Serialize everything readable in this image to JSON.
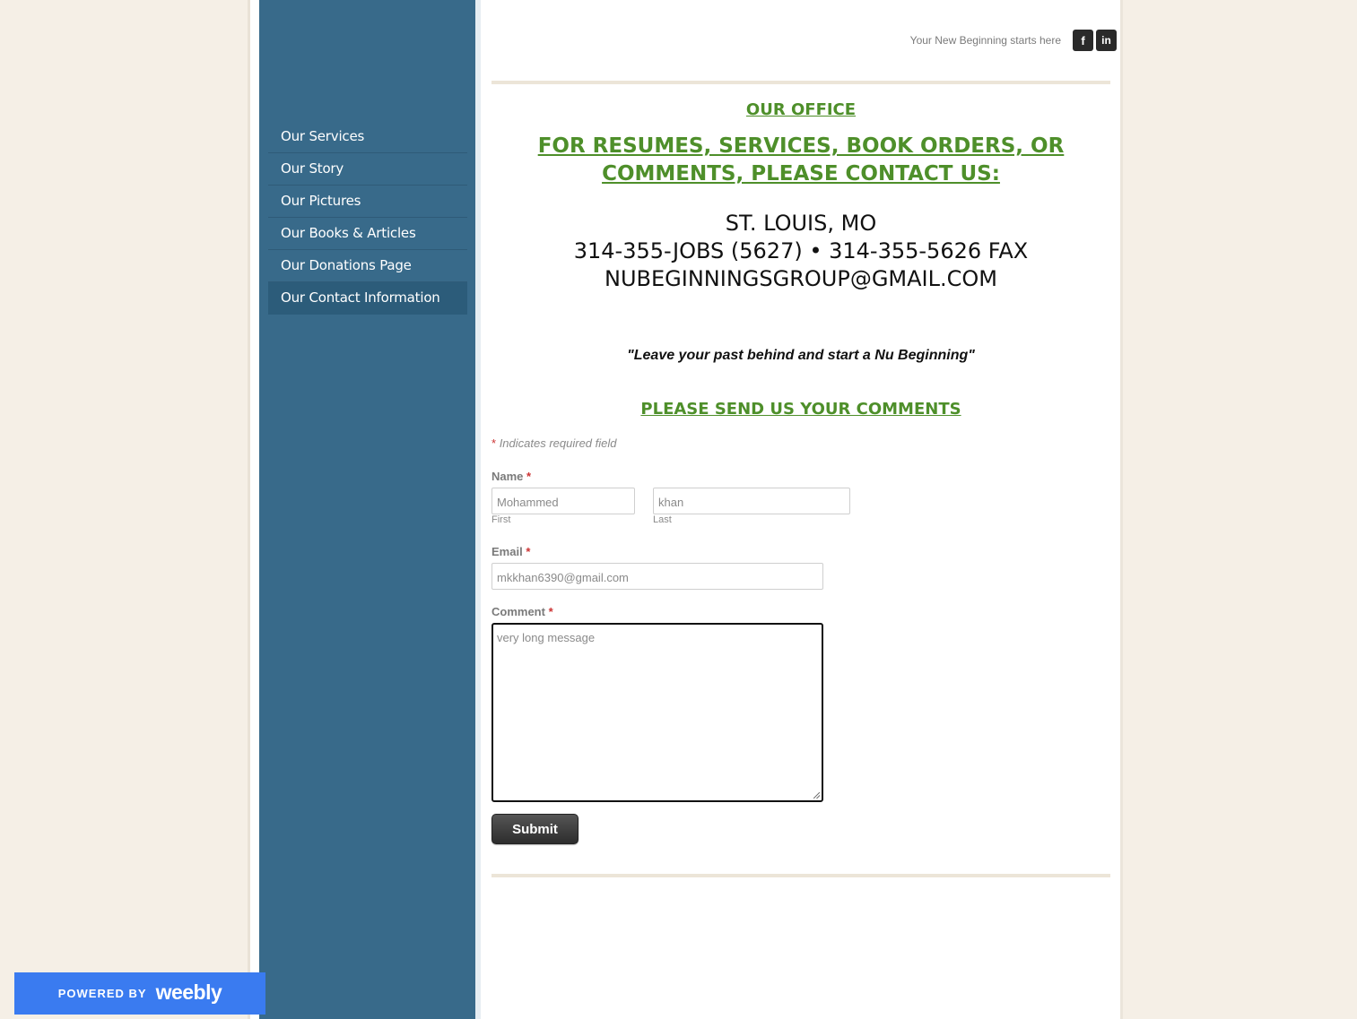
{
  "header": {
    "tagline": "Your New Beginning starts here",
    "social": {
      "facebook": "f",
      "linkedin": "in"
    }
  },
  "sidebar": {
    "items": [
      {
        "label": "Our Services"
      },
      {
        "label": "Our Story"
      },
      {
        "label": "Our Pictures"
      },
      {
        "label": "Our Books & Articles"
      },
      {
        "label": "Our Donations Page"
      },
      {
        "label": "Our Contact Information"
      }
    ],
    "active_index": 5
  },
  "office": {
    "title": "OUR OFFICE",
    "contact_heading_1": "FOR RESUMES, SERVICES, BOOK ORDERS, OR",
    "contact_heading_2": "COMMENTS, PLEASE CONTACT US:",
    "location": "ST. LOUIS, MO",
    "phones": "314-355-JOBS (5627) • 314-355-5626 FAX",
    "email": "NUBEGINNINGSGROUP@GMAIL.COM"
  },
  "quote": "\"Leave your past behind and start a Nu Beginning\"",
  "form": {
    "title": "PLEASE SEND US YOUR COMMENTS",
    "required_note": "Indicates required field",
    "required_mark": "*",
    "name_label": "Name",
    "first_value": "Mohammed",
    "first_sub": "First",
    "last_value": "khan",
    "last_sub": "Last",
    "email_label": "Email",
    "email_value": "mkkhan6390@gmail.com",
    "comment_label": "Comment",
    "comment_value": "very long message",
    "submit_label": "Submit"
  },
  "footer": {
    "powered_by": "POWERED BY",
    "brand": "weebly"
  },
  "colors": {
    "background": "#f5efe6",
    "sidebar": "#386a8a",
    "heading_green": "#4e8f2a",
    "badge_blue": "#3a7bf0"
  }
}
